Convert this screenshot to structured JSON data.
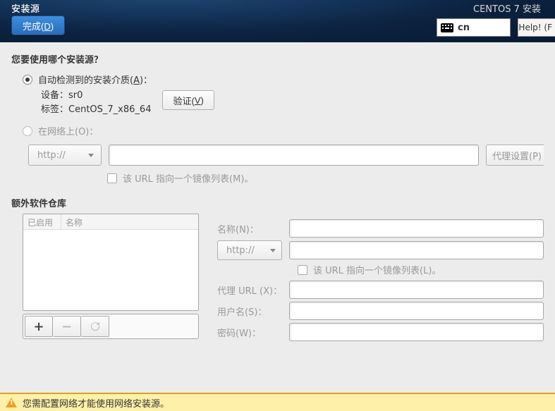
{
  "header": {
    "title": "安装源",
    "done_pre": "完成(",
    "done_u": "D",
    "done_post": ")",
    "installer": "CENTOS 7 安装",
    "lang": "cn",
    "help": "Help! (F"
  },
  "src": {
    "question": "您要使用哪个安装源？",
    "auto_pre": "自动检测到的安装介质(",
    "auto_u": "A",
    "auto_post": ")：",
    "device_lbl": "设备：",
    "device_val": "sr0",
    "label_lbl": "标签：",
    "label_val": "CentOS_7_x86_64",
    "verify_pre": "验证(",
    "verify_u": "V",
    "verify_post": ")",
    "net_label": "在网络上(O)：",
    "protocol": "http://",
    "proxy_label": "代理设置(P)",
    "mirror_label": "该 URL 指向一个镜像列表(M)。"
  },
  "repo": {
    "section": "额外软件仓库",
    "col1": "已启用",
    "col2": "名称",
    "name_lbl": "名称(N)：",
    "protocol": "http://",
    "mirror_label": "该 URL 指向一个镜像列表(L)。",
    "proxy_url_lbl": "代理 URL (X)：",
    "user_lbl": "用户名(S)：",
    "pass_lbl": "密码(W)："
  },
  "warn": {
    "msg": "您需配置网络才能使用网络安装源。"
  }
}
